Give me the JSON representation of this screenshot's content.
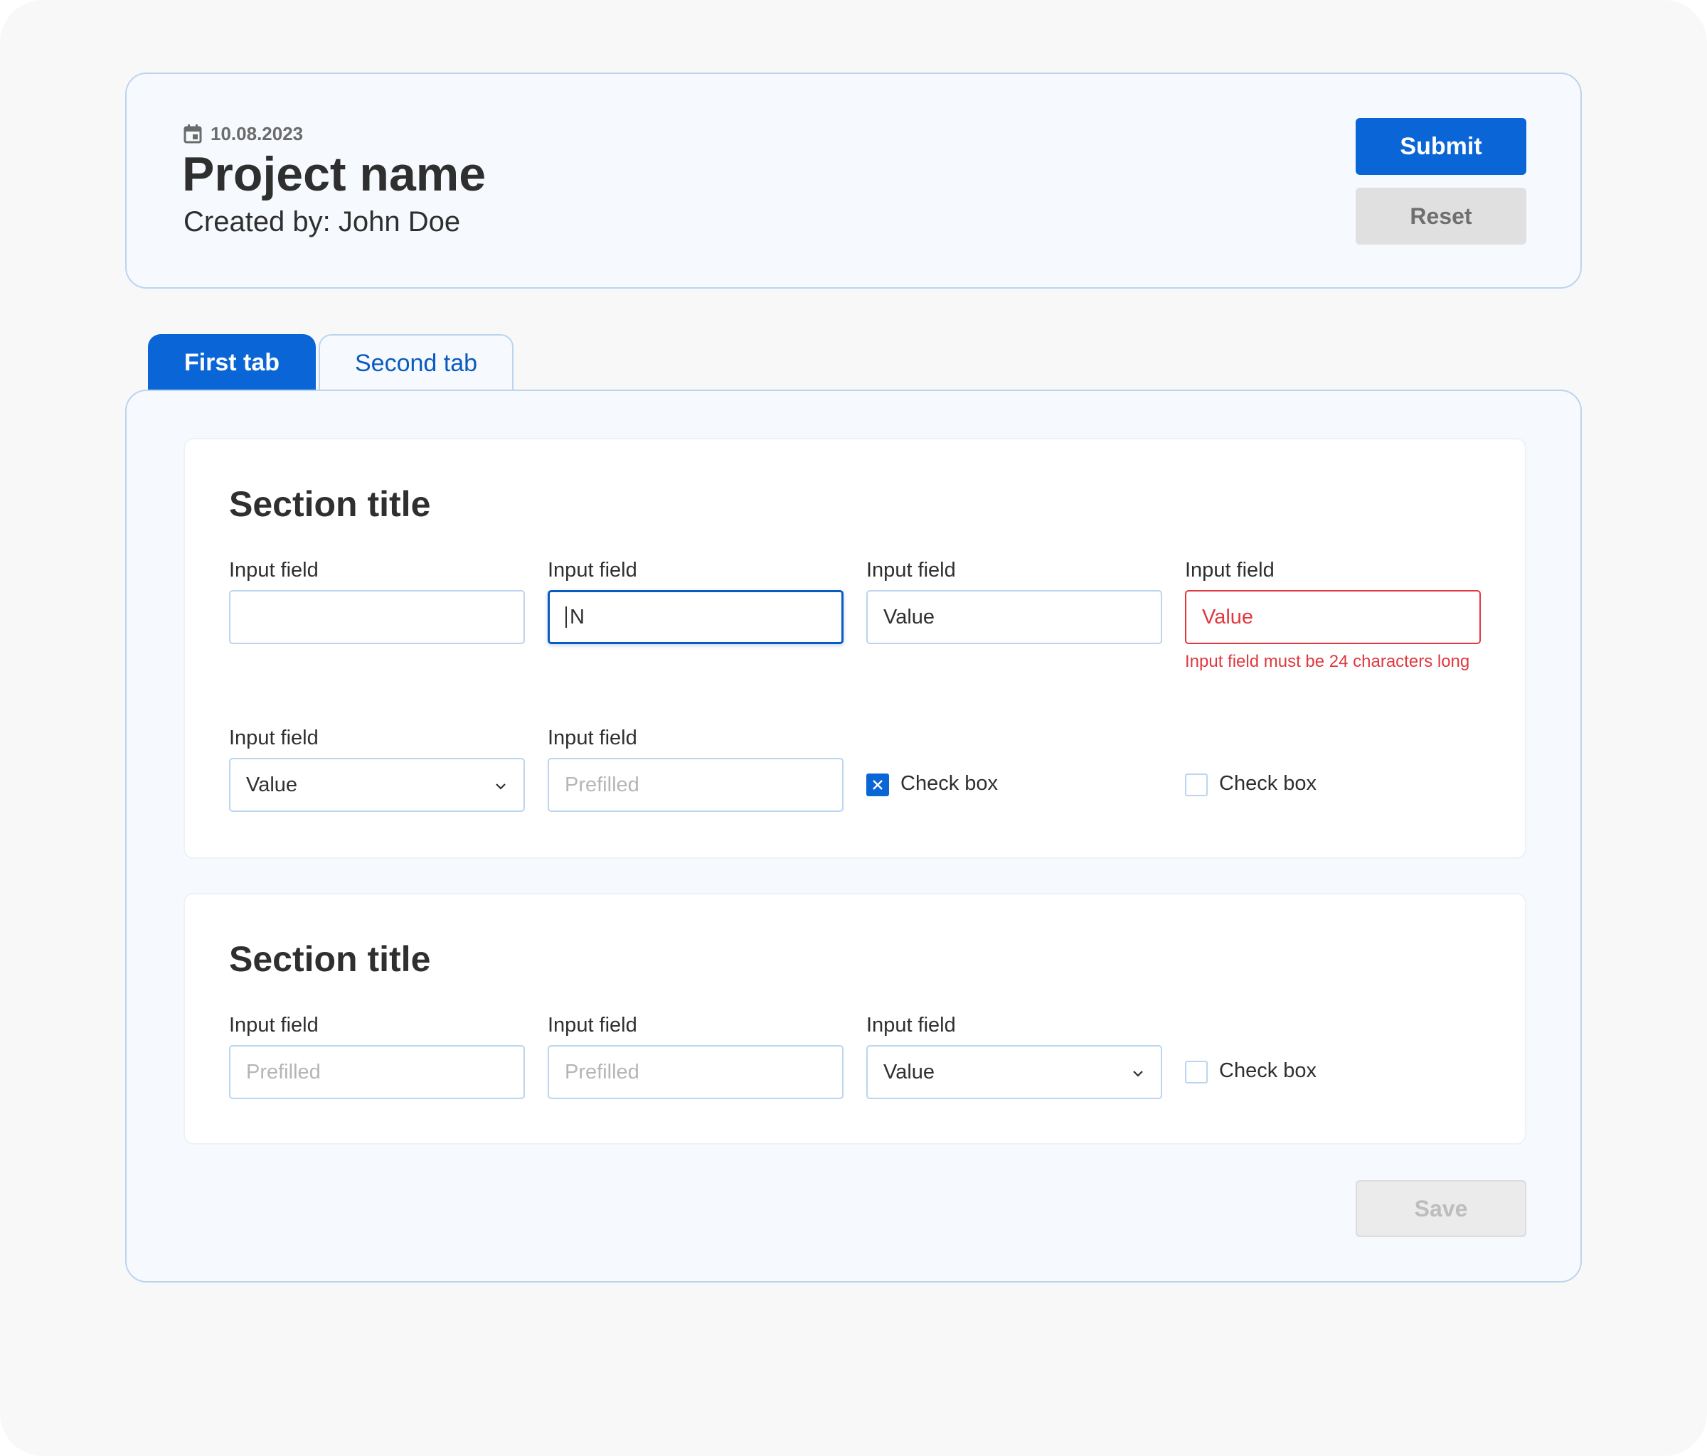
{
  "header": {
    "date": "10.08.2023",
    "title": "Project name",
    "created_by": "Created by: John Doe",
    "submit_label": "Submit",
    "reset_label": "Reset"
  },
  "tabs": [
    {
      "label": "First tab",
      "active": true
    },
    {
      "label": "Second tab",
      "active": false
    }
  ],
  "sections": [
    {
      "title": "Section title",
      "fields": [
        {
          "label": "Input field",
          "value": ""
        },
        {
          "label": "Input field",
          "value": "N",
          "state": "focused"
        },
        {
          "label": "Input field",
          "value": "Value"
        },
        {
          "label": "Input field",
          "value": "Value",
          "state": "error",
          "error": "Input field must be 24 characters long"
        },
        {
          "label": "Input field",
          "value": "Value",
          "type": "select"
        },
        {
          "label": "Input field",
          "placeholder": "Prefilled"
        }
      ],
      "checkboxes": [
        {
          "label": "Check box",
          "checked": true
        },
        {
          "label": "Check box",
          "checked": false
        }
      ]
    },
    {
      "title": "Section title",
      "fields": [
        {
          "label": "Input field",
          "placeholder": "Prefilled"
        },
        {
          "label": "Input field",
          "placeholder": "Prefilled"
        },
        {
          "label": "Input field",
          "value": "Value",
          "type": "select"
        }
      ],
      "checkboxes": [
        {
          "label": "Check box",
          "checked": false
        }
      ]
    }
  ],
  "footer": {
    "save_label": "Save"
  },
  "colors": {
    "primary": "#0a66d6",
    "error": "#e0383e",
    "border": "#bcd4ee"
  }
}
